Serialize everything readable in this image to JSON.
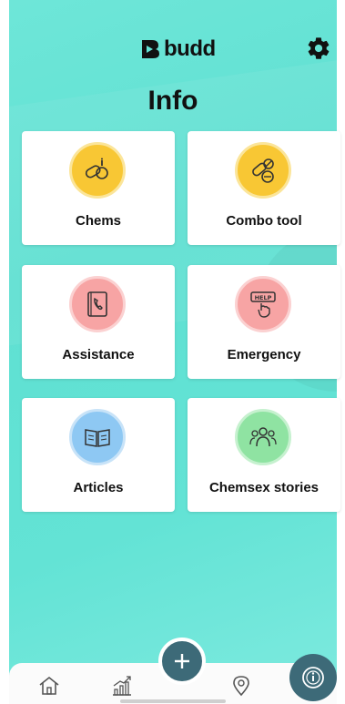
{
  "app": {
    "logo_text": "budd"
  },
  "page": {
    "title": "Info"
  },
  "cards": [
    {
      "label": "Chems",
      "icon": "pills-icon",
      "color": "#f8c734"
    },
    {
      "label": "Combo tool",
      "icon": "combo-pills-icon",
      "color": "#f8c734"
    },
    {
      "label": "Assistance",
      "icon": "phone-book-icon",
      "color": "#f7a4a4"
    },
    {
      "label": "Emergency",
      "icon": "help-sign-icon",
      "color": "#f7a4a4"
    },
    {
      "label": "Articles",
      "icon": "open-book-icon",
      "color": "#8ec8f3"
    },
    {
      "label": "Chemsex stories",
      "icon": "people-group-icon",
      "color": "#8fe3a2"
    }
  ],
  "nav": {
    "items": [
      "home-icon",
      "stats-chart-icon",
      "add-icon",
      "location-pin-icon",
      "info-icon"
    ]
  },
  "colors": {
    "accent": "#3d6a78",
    "background": "#63e3d5"
  }
}
